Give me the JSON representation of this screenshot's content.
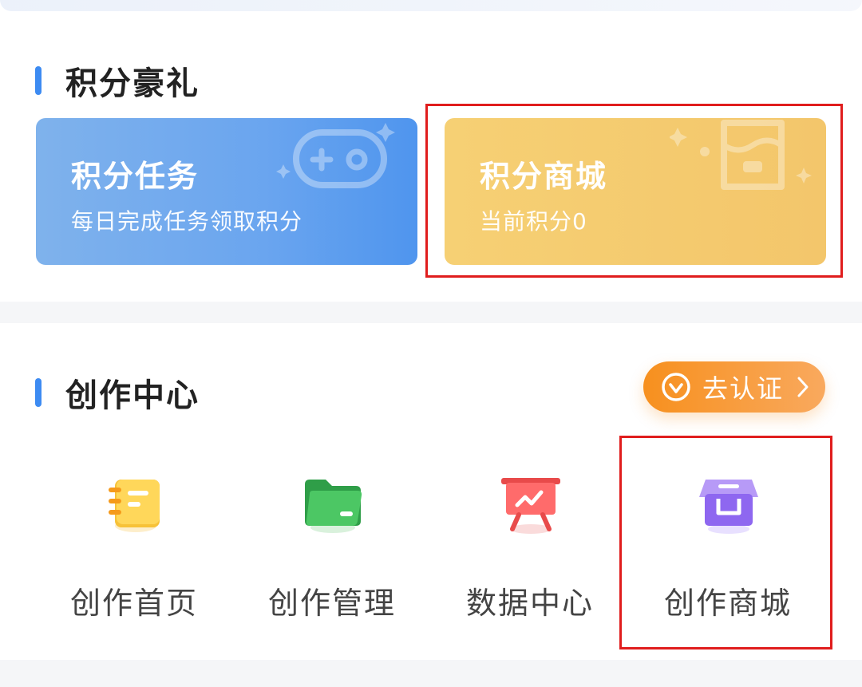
{
  "points_section": {
    "title": "积分豪礼",
    "cards": [
      {
        "title": "积分任务",
        "subtitle": "每日完成任务领取积分"
      },
      {
        "title": "积分商城",
        "subtitle": "当前积分0"
      }
    ]
  },
  "creation_section": {
    "title": "创作中心",
    "verify_button": "去认证",
    "items": [
      {
        "label": "创作首页",
        "icon": "notebook-icon"
      },
      {
        "label": "创作管理",
        "icon": "folder-icon"
      },
      {
        "label": "数据中心",
        "icon": "presentation-chart-icon"
      },
      {
        "label": "创作商城",
        "icon": "store-icon"
      }
    ]
  },
  "colors": {
    "accent_blue": "#3d8bf2",
    "task_card": "#6aa5ef",
    "mall_card": "#f3c66b",
    "verify_orange": "#f7901e",
    "highlight_red": "#e01d1d"
  }
}
